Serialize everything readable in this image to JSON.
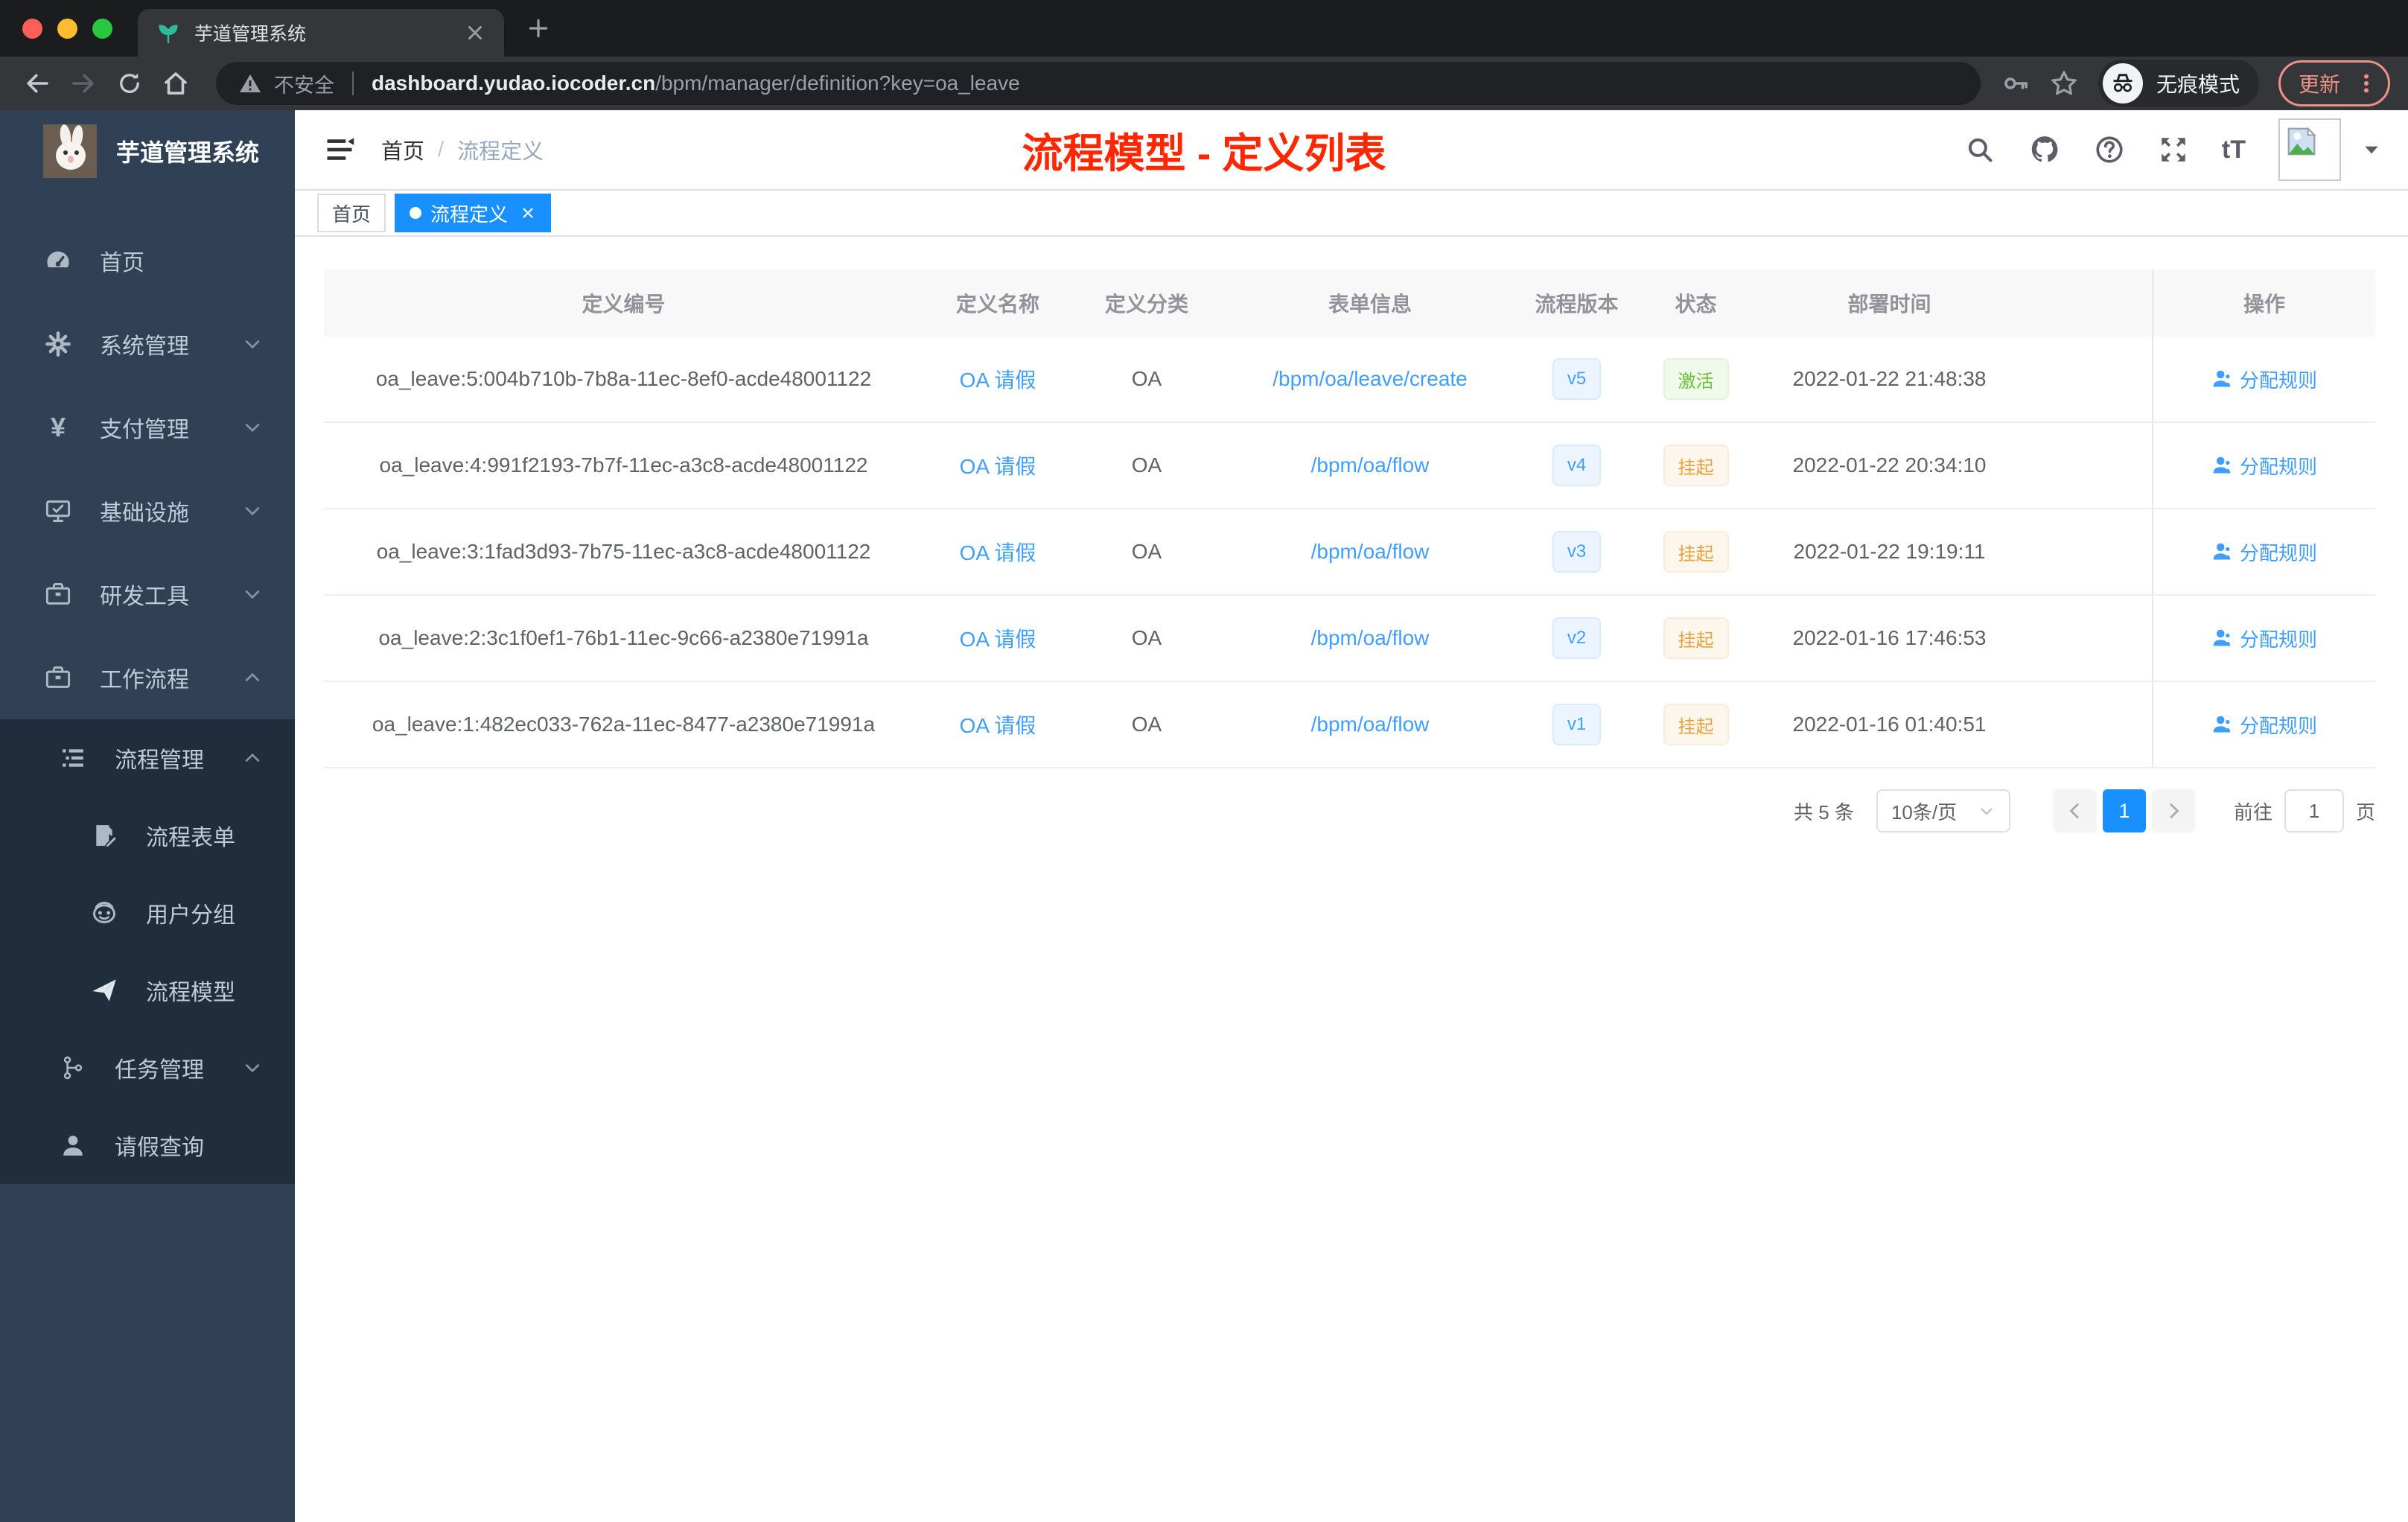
{
  "browser": {
    "tab_title": "芋道管理系统",
    "security_label": "不安全",
    "url_host": "dashboard.yudao.iocoder.cn",
    "url_path": "/bpm/manager/definition?key=oa_leave",
    "incognito_label": "无痕模式",
    "update_label": "更新"
  },
  "sidebar": {
    "title": "芋道管理系统",
    "items": [
      {
        "label": "首页",
        "icon": "dashboard-icon"
      },
      {
        "label": "系统管理",
        "icon": "gear-icon"
      },
      {
        "label": "支付管理",
        "icon": "yen-icon"
      },
      {
        "label": "基础设施",
        "icon": "monitor-icon"
      },
      {
        "label": "研发工具",
        "icon": "briefcase-icon"
      },
      {
        "label": "工作流程",
        "icon": "briefcase-icon",
        "expanded": true
      }
    ],
    "submenu": {
      "header": {
        "label": "流程管理",
        "expanded": true
      },
      "children": [
        {
          "label": "流程表单",
          "icon": "form-icon"
        },
        {
          "label": "用户分组",
          "icon": "robot-icon"
        },
        {
          "label": "流程模型",
          "icon": "send-icon"
        }
      ],
      "tail": [
        {
          "label": "任务管理",
          "icon": "tree-icon"
        },
        {
          "label": "请假查询",
          "icon": "user-icon"
        }
      ]
    }
  },
  "navbar": {
    "breadcrumb": {
      "home": "首页",
      "sep": "/",
      "current": "流程定义"
    },
    "page_title": "流程模型 - 定义列表",
    "font_icon_label": "tT"
  },
  "tags": [
    {
      "label": "首页",
      "active": false
    },
    {
      "label": "流程定义",
      "active": true
    }
  ],
  "table": {
    "columns": [
      "定义编号",
      "定义名称",
      "定义分类",
      "表单信息",
      "流程版本",
      "状态",
      "部署时间",
      "操作"
    ],
    "action_label": "分配规则",
    "rows": [
      {
        "id": "oa_leave:5:004b710b-7b8a-11ec-8ef0-acde48001122",
        "name": "OA 请假",
        "category": "OA",
        "form": "/bpm/oa/leave/create",
        "version": "v5",
        "status": "激活",
        "status_type": "success",
        "time": "2022-01-22 21:48:38"
      },
      {
        "id": "oa_leave:4:991f2193-7b7f-11ec-a3c8-acde48001122",
        "name": "OA 请假",
        "category": "OA",
        "form": "/bpm/oa/flow",
        "version": "v4",
        "status": "挂起",
        "status_type": "warning",
        "time": "2022-01-22 20:34:10"
      },
      {
        "id": "oa_leave:3:1fad3d93-7b75-11ec-a3c8-acde48001122",
        "name": "OA 请假",
        "category": "OA",
        "form": "/bpm/oa/flow",
        "version": "v3",
        "status": "挂起",
        "status_type": "warning",
        "time": "2022-01-22 19:19:11"
      },
      {
        "id": "oa_leave:2:3c1f0ef1-76b1-11ec-9c66-a2380e71991a",
        "name": "OA 请假",
        "category": "OA",
        "form": "/bpm/oa/flow",
        "version": "v2",
        "status": "挂起",
        "status_type": "warning",
        "time": "2022-01-16 17:46:53"
      },
      {
        "id": "oa_leave:1:482ec033-762a-11ec-8477-a2380e71991a",
        "name": "OA 请假",
        "category": "OA",
        "form": "/bpm/oa/flow",
        "version": "v1",
        "status": "挂起",
        "status_type": "warning",
        "time": "2022-01-16 01:40:51"
      }
    ]
  },
  "pagination": {
    "total_label": "共 5 条",
    "page_size_label": "10条/页",
    "current_page": "1",
    "goto_label": "前往",
    "goto_value": "1",
    "unit_label": "页"
  }
}
